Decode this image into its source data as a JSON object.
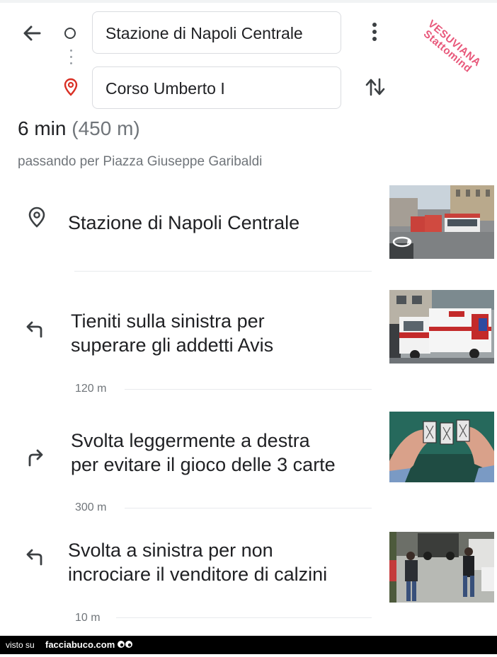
{
  "route": {
    "origin_value": "Stazione di Napoli Centrale",
    "destination_value": "Corso Umberto I"
  },
  "summary": {
    "duration": "6 min",
    "distance": "(450 m)",
    "via": "passando per Piazza Giuseppe Garibaldi"
  },
  "watermark": {
    "line1": "VESUVIANA",
    "line2": "Stattomind"
  },
  "steps": [
    {
      "icon": "place-pin-icon",
      "text_line1": "Stazione di Napoli Centrale",
      "text_line2": "",
      "distance": ""
    },
    {
      "icon": "turn-left-icon",
      "text_line1": "Tieniti sulla sinistra per",
      "text_line2": "superare gli addetti Avis",
      "distance": "120 m"
    },
    {
      "icon": "turn-slight-right-icon",
      "text_line1": "Svolta leggermente a destra",
      "text_line2": "per evitare il gioco delle 3 carte",
      "distance": "300 m"
    },
    {
      "icon": "turn-left-icon",
      "text_line1": "Svolta a sinistra per non",
      "text_line2": "incrociare il venditore di calzini",
      "distance": "10 m"
    }
  ],
  "footer": {
    "visto_su": "visto su",
    "site": "facciabuco.com"
  },
  "colors": {
    "accent_red": "#d93025",
    "watermark_pink": "#e8577a",
    "secondary_text": "#70757a"
  }
}
